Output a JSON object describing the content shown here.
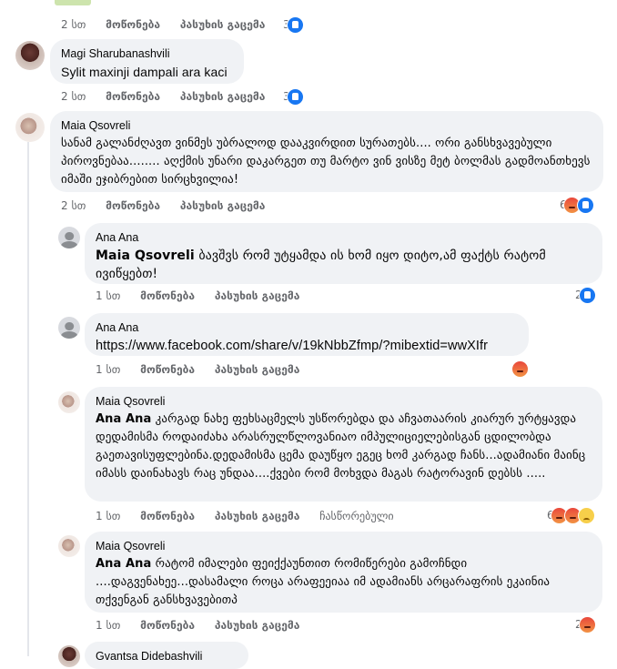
{
  "comments": [
    {
      "id": "c0",
      "meta": {
        "time": "2 სთ",
        "like": "მოწონება",
        "reply": "პასუხის გაცემა"
      },
      "reaction_count": "3",
      "reactions": [
        "like-icon"
      ]
    },
    {
      "id": "c1",
      "author": "Magi Sharubanashvili",
      "text": "Sylit maxinji dampali ara kaci",
      "meta": {
        "time": "2 სთ",
        "like": "მოწონება",
        "reply": "პასუხის გაცემა"
      },
      "reaction_count": "3",
      "reactions": [
        "like-icon"
      ]
    },
    {
      "id": "c2",
      "author": "Maia Qsovreli",
      "text": "სანამ გალანძღავთ ვინმეს უბრალოდ დააკვირდით სურათებს.... ორი განსხვავებული პიროვნებაა........ აღქმის უნარი დაკარგეთ თუ მარტო ვინ ვისზე მეტ ბოლმას გადმოანთხევს იმაში ეჯიბრებით სირცხვილია!",
      "meta": {
        "time": "2 სთ",
        "like": "მოწონება",
        "reply": "პასუხის გაცემა"
      },
      "reaction_count": "6",
      "reactions": [
        "angry-icon",
        "like-icon"
      ]
    },
    {
      "id": "r1",
      "author": "Ana Ana",
      "mention": "Maia Qsovreli",
      "text": " ბავშვს რომ უტყამდა ის ხომ იყო დიტო,ამ ფაქტს რატომ ივიწყებთ!",
      "meta": {
        "time": "1 სთ",
        "like": "მოწონება",
        "reply": "პასუხის გაცემა"
      },
      "reaction_count": "2",
      "reactions": [
        "like-icon"
      ]
    },
    {
      "id": "r2",
      "author": "Ana Ana",
      "text": "https://www.facebook.com/share/v/19kNbbZfmp/?mibextid=wwXIfr",
      "meta": {
        "time": "1 სთ",
        "like": "მოწონება",
        "reply": "პასუხის გაცემა"
      },
      "reaction_count": "",
      "reactions": [
        "angry-icon"
      ]
    },
    {
      "id": "r3",
      "author": "Maia Qsovreli",
      "mention": "Ana Ana",
      "text": " კარგად ნახე ფეხსაცმელს უსწორებდა და აჩვათაარის კიარურ ურტყავდა დედამისმა როდაიძახა არასრულწლოვანიაო იმპულიციელებისგან ცდილობდა გაეთავისუფლებინა.დედამისმა ცემა დაუწყო ეგეც ხომ კარგად ჩანს...ადამიანი მაინც იმასს დაინახავს რაც უნდაა....ქვები რომ მოხვდა მაგას რატორავინ დებსს .....",
      "meta": {
        "time": "1 სთ",
        "like": "მოწონება",
        "reply": "პასუხის გაცემა",
        "edited": "ჩასწორებული"
      },
      "reaction_count": "6",
      "reactions": [
        "angry-icon",
        "angry-icon",
        "sad-icon"
      ]
    },
    {
      "id": "r4",
      "author": "Maia Qsovreli",
      "mention": "Ana Ana",
      "text": " რატომ იმალები ფეიქქაუნთით რომიწერები გამოჩნდი ....დაგვენახეე...დასამალი როცა არაფეეიაა იმ ადამიანს არცარაფრის ეკაინია თქვენგან განსხვავებითპ",
      "meta": {
        "time": "1 სთ",
        "like": "მოწონება",
        "reply": "პასუხის გაცემა"
      },
      "reaction_count": "2",
      "reactions": [
        "angry-icon"
      ]
    },
    {
      "id": "r5",
      "author": "Gvantsa Didebashvili"
    }
  ],
  "colors": {
    "bubble": "#f0f2f5",
    "meta": "#65676b",
    "like": "#1877f2",
    "angry": "#e9473b"
  }
}
